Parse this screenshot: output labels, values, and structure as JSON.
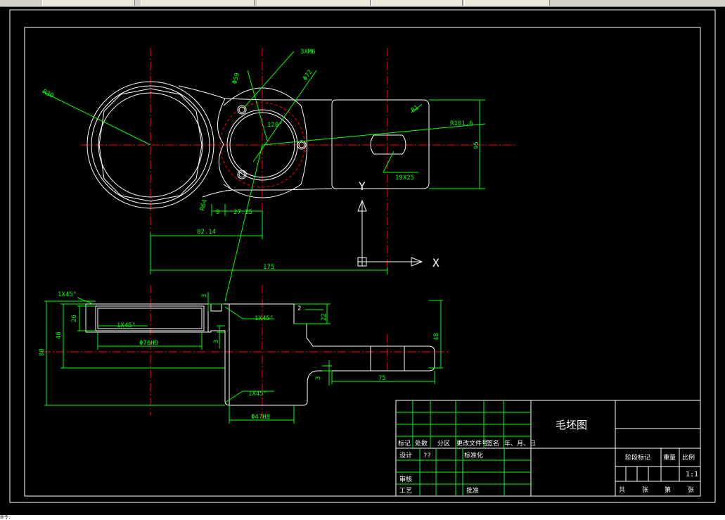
{
  "drawing": {
    "title_block_name": "毛坯图",
    "scale_value": "1:1",
    "hdr_mark": "标记",
    "hdr_count": "处数",
    "hdr_zone": "分区",
    "hdr_change_doc": "更改文件号",
    "hdr_sign": "签名",
    "hdr_date": "年、月、日",
    "row_design": "设计",
    "row_design_value": "??",
    "row_standardize": "标准化",
    "row_review": "审核",
    "row_process": "工艺",
    "row_approve": "批准",
    "stage_mark": "阶段标记",
    "weight": "重量",
    "scale": "比例",
    "total_sheets": "共",
    "sheet_unit": "张",
    "sheet_no": "第",
    "sheet_unit2": "张"
  },
  "dimensions": {
    "r30": "R30",
    "m6": "3XM6",
    "d59": "Φ59",
    "d72": "Φ72",
    "r1": "R1",
    "r101_6": "R101.6",
    "d120": "120°",
    "h95": "95",
    "slot": "19X25",
    "r64": "R64",
    "d9": "9",
    "d27_25": "27.25",
    "d82_14": "82.14",
    "d175": "175",
    "ch1": "1X45°",
    "ch2": "1X45°",
    "ch3": "1X45°",
    "ch4": "1X45°",
    "d3a": "3",
    "d2": "2",
    "d22": "22",
    "d26": "26",
    "d46": "46",
    "d80": "80",
    "d3b": "3",
    "d48": "48",
    "d3c": "3",
    "d75": "75",
    "bore1": "Φ76H9",
    "bore2": "Φ47H8"
  },
  "axis": {
    "x": "X",
    "y": "Y"
  },
  "status": {
    "coords": "命令:"
  },
  "colors": {
    "background": "#000000",
    "outline": "#ffffff",
    "dimension": "#00ff00",
    "center": "#ff0000"
  }
}
